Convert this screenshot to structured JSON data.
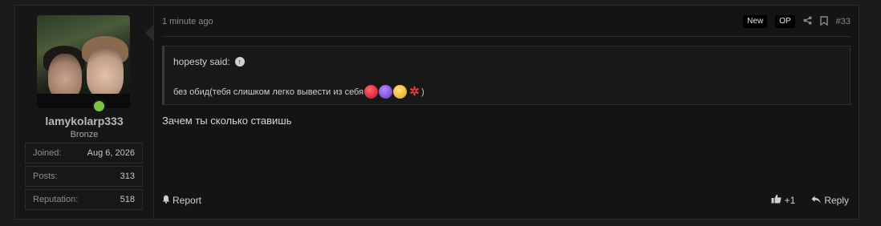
{
  "user": {
    "username": "lamykolarp333",
    "rank": "Bronze",
    "stats": [
      {
        "label": "Joined:",
        "value": "Aug 6, 2026"
      },
      {
        "label": "Posts:",
        "value": "313"
      },
      {
        "label": "Reputation:",
        "value": "518"
      }
    ],
    "online_color": "#7cc242"
  },
  "post": {
    "time": "1 minute ago",
    "badge_new": "New",
    "badge_op": "OP",
    "number": "#33",
    "quote": {
      "author": "hopesty said:",
      "text": "без обид(тебя слишком легко вывести из себя",
      "text_end": ")"
    },
    "message": "Зачем ты сколько ставишь",
    "report_label": "Report",
    "like_label": "+1",
    "reply_label": "Reply"
  },
  "icons": {
    "share": "share-icon",
    "bookmark": "bookmark-icon",
    "report": "bell-icon",
    "like": "thumbs-up-icon",
    "reply": "reply-icon",
    "quote_link": "arrow-up-circle-icon"
  }
}
